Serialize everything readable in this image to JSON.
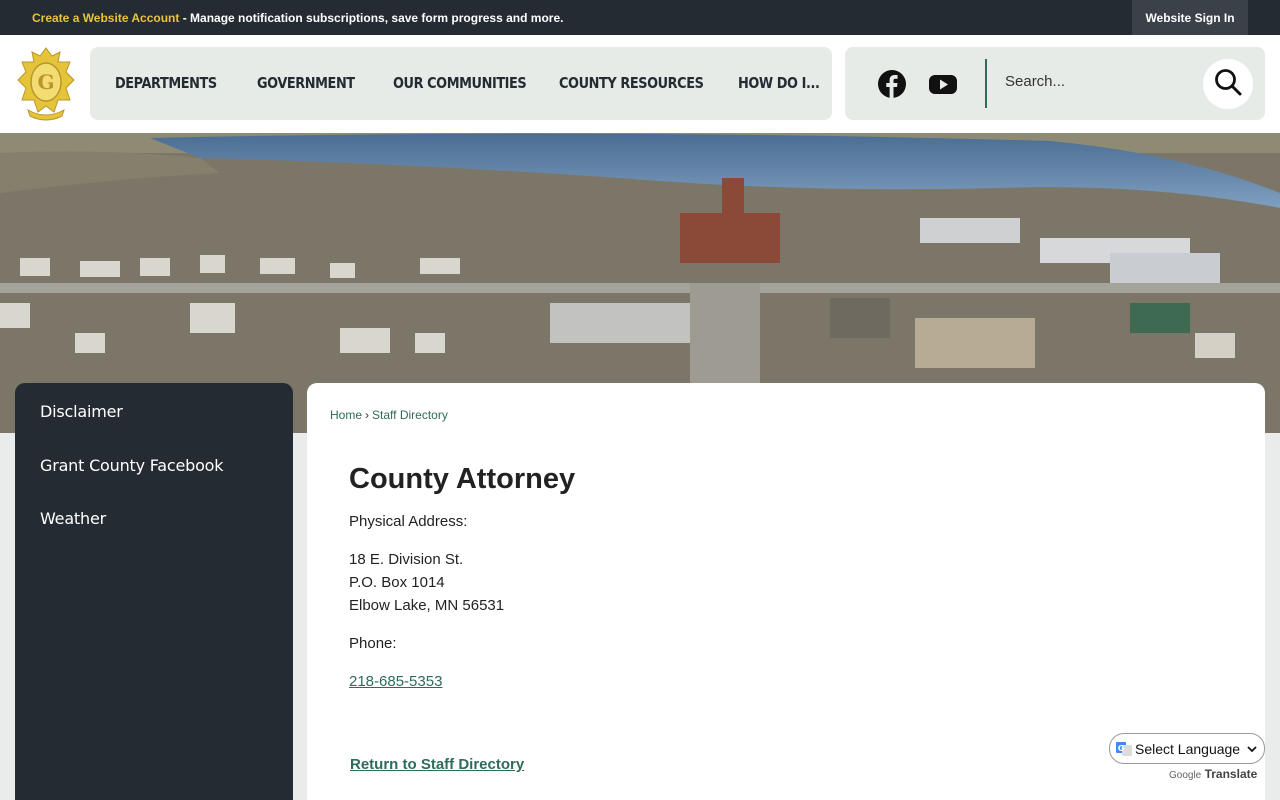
{
  "topbar": {
    "account_link": "Create a Website Account",
    "account_desc": " - Manage notification subscriptions, save form progress and more.",
    "sign_in": "Website Sign In"
  },
  "nav": {
    "items": [
      "DEPARTMENTS",
      "GOVERNMENT",
      "OUR COMMUNITIES",
      "COUNTY RESOURCES",
      "HOW DO I..."
    ]
  },
  "search": {
    "placeholder": "Search..."
  },
  "sidebar": {
    "items": [
      "Disclaimer",
      "Grant County Facebook",
      "Weather"
    ]
  },
  "breadcrumb": {
    "home": "Home",
    "sep": "›",
    "current": "Staff Directory"
  },
  "main": {
    "title": "County Attorney",
    "address_label": "Physical Address:",
    "address_line1": "18 E. Division St.",
    "address_line2": "P.O. Box 1014",
    "address_line3": "Elbow Lake, MN 56531",
    "phone_label": "Phone:",
    "phone": "218-685-5353",
    "return_link": "Return to Staff Directory"
  },
  "translate": {
    "select_label": "Select Language",
    "powered_by": "Google",
    "translate_word": "Translate"
  },
  "colors": {
    "dark": "#242b33",
    "accent_gold": "#e8c33b",
    "link_green": "#2e6b5b",
    "nav_bg": "#e7ebe8"
  },
  "icons": [
    "county-seal-logo",
    "facebook-icon",
    "youtube-icon",
    "search-icon",
    "google-translate-icon",
    "chevron-down-icon"
  ]
}
